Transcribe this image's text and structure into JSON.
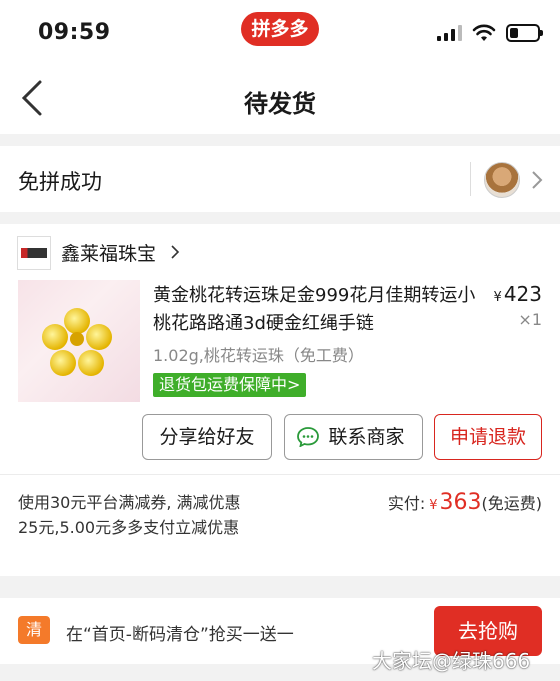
{
  "status_bar": {
    "time": "09:59",
    "app_name": "拼多多",
    "icons": [
      "signal-icon",
      "wifi-icon",
      "battery-icon"
    ]
  },
  "nav": {
    "title": "待发货",
    "back_icon": "chevron-left-icon"
  },
  "order_status": {
    "text": "免拼成功"
  },
  "store": {
    "name": "鑫莱福珠宝"
  },
  "product": {
    "title": "黄金桃花转运珠足金999花月佳期转运小桃花路路通3d硬金红绳手链",
    "currency": "¥",
    "price": "423",
    "quantity": "×1",
    "spec": "1.02g,桃花转运珠（免工费）",
    "guarantee": "退货包运费保障中>"
  },
  "actions": {
    "share": "分享给好友",
    "contact": "联系商家",
    "refund": "申请退款"
  },
  "payment": {
    "promo": "使用30元平台满减券, 满减优惠25元,5.00元多多支付立减优惠",
    "paid_label": "实付:",
    "currency": "¥",
    "paid_amount": "363",
    "shipping": "(免运费)"
  },
  "banner": {
    "icon_label": "清",
    "text": "在“首页-断码清仓”抢买一送一",
    "button": "去抢购"
  },
  "watermark": "大家坛@绿珠666",
  "colors": {
    "brand_red": "#e02e24",
    "green_badge": "#3fae2a",
    "orange": "#f47a2a"
  }
}
